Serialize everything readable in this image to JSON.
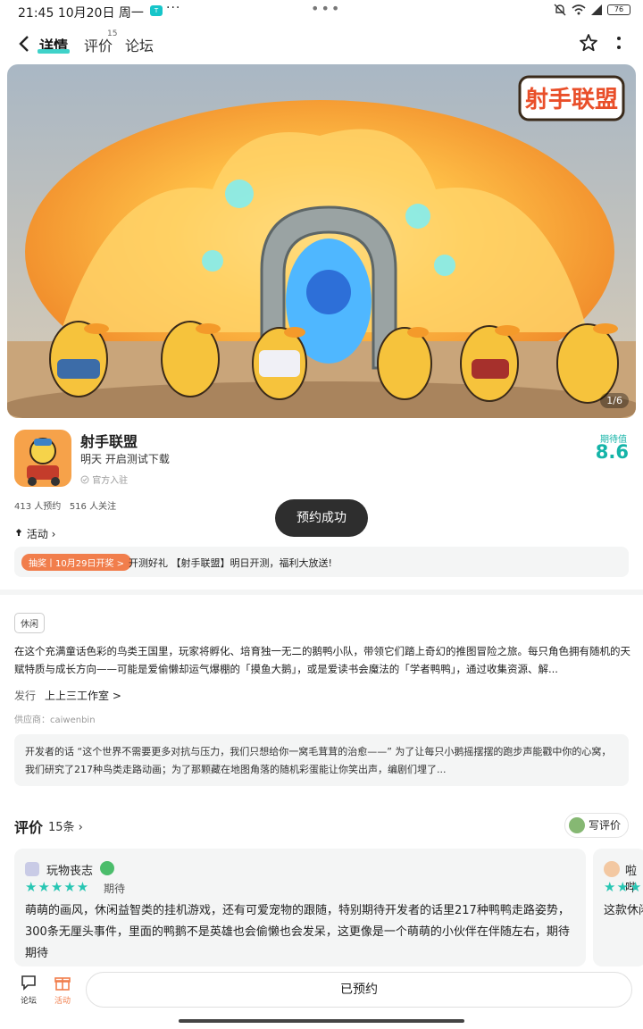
{
  "status": {
    "time": "21:45",
    "date": "10月20日 周一",
    "battery": "76"
  },
  "nav": {
    "tabs": [
      {
        "label": "详情"
      },
      {
        "label": "评价"
      },
      {
        "label": "论坛"
      }
    ],
    "review_count_sup": "15"
  },
  "hero": {
    "pager": "1/6",
    "logo_text": "射手联盟"
  },
  "game": {
    "name": "射手联盟",
    "status": "明天 开启测试下载",
    "official": "官方入驻",
    "expect_label": "期待值",
    "expect_value": "8.6",
    "reserve_count": "413 人预约",
    "follow_count": "516 人关注"
  },
  "toast": "预约成功",
  "events": {
    "label": "活动",
    "badge": "抽奖丨10月29日开奖 >",
    "text": "开测好礼 【射手联盟】明日开测，福利大放送!"
  },
  "detail": {
    "tag": "休闲",
    "description": "在这个充满童话色彩的鸟类王国里，玩家将孵化、培育独一无二的鹅鸭小队，带领它们踏上奇幻的推图冒险之旅。每只角色拥有随机的天赋特质与成长方向——可能是爱偷懒却运气爆棚的「摸鱼大鹅」，或是爱读书会魔法的「学者鸭鸭」，通过收集资源、解...",
    "publisher_label": "发行",
    "publisher": "上上三工作室 >",
    "supplier": "供应商：caiwenbin",
    "developer_note": "开发者的话 “这个世界不需要更多对抗与压力，我们只想给你一窝毛茸茸的治愈——” 为了让每只小鹅摇摆摆的跑步声能戳中你的心窝，我们研究了217种鸟类走路动画；为了那颗藏在地图角落的随机彩蛋能让你笑出声，编剧们埋了..."
  },
  "reviews": {
    "title": "评价",
    "count": "15条",
    "write_label": "写评价",
    "items": [
      {
        "user": "玩物丧志",
        "rating_label": "期待",
        "text": "萌萌的画风，休闲益智类的挂机游戏，还有可爱宠物的跟随，特别期待开发者的话里217种鸭鸭走路姿势，300条无厘头事件，里面的鸭鹅不是英雄也会偷懒也会发呆，这更像是一个萌萌的小伙伴在伴随左右，期待期待"
      },
      {
        "user": "啦哔",
        "rating_label": "",
        "text": "这款休闲"
      }
    ]
  },
  "bottom": {
    "forum": "论坛",
    "events": "活动",
    "reserved": "已预约"
  },
  "colors": {
    "accent": "#15b4a8",
    "badge": "#f17e4c",
    "star": "#28c6b3"
  }
}
